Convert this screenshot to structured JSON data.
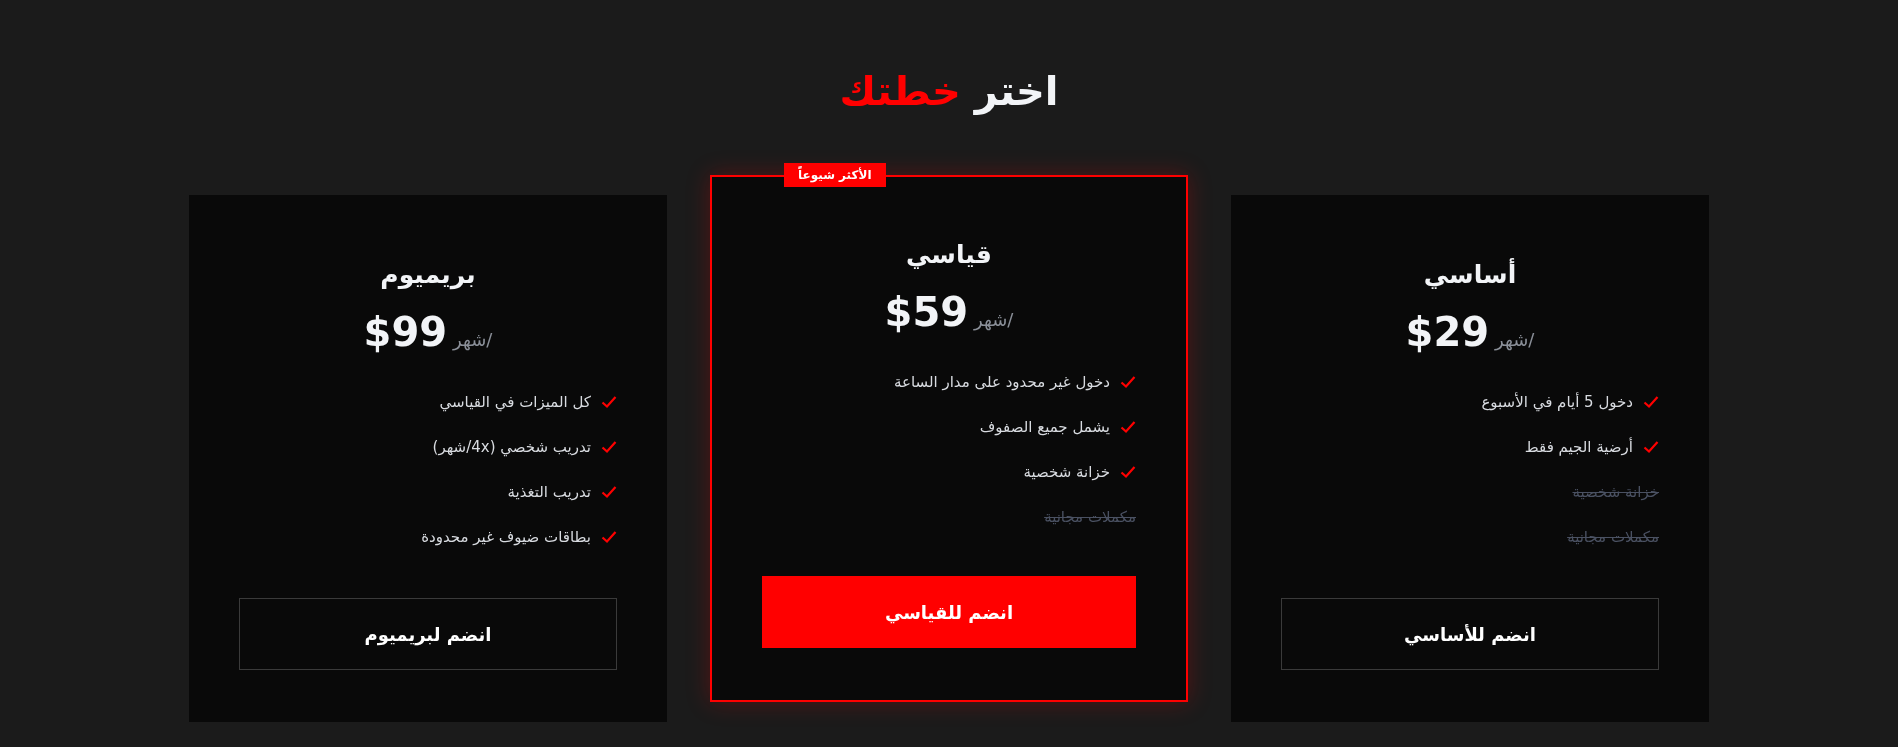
{
  "title": {
    "lead": "اختر",
    "highlight": "خطتك"
  },
  "plans": [
    {
      "name": "أساسي",
      "price": "$29",
      "period": "/شهر",
      "featured": false,
      "features": [
        {
          "text": "دخول 5 أيام في الأسبوع",
          "included": true
        },
        {
          "text": "أرضية الجيم فقط",
          "included": true
        },
        {
          "text": "خزانة شخصية",
          "included": false
        },
        {
          "text": "مكملات مجانية",
          "included": false
        }
      ],
      "button": "انضم للأساسي"
    },
    {
      "name": "قياسي",
      "price": "$59",
      "period": "/شهر",
      "featured": true,
      "badge": "الأكثر شيوعاً",
      "features": [
        {
          "text": "دخول غير محدود على مدار الساعة",
          "included": true
        },
        {
          "text": "يشمل جميع الصفوف",
          "included": true
        },
        {
          "text": "خزانة شخصية",
          "included": true
        },
        {
          "text": "مكملات مجانية",
          "included": false
        }
      ],
      "button": "انضم للقياسي"
    },
    {
      "name": "بريميوم",
      "price": "$99",
      "period": "/شهر",
      "featured": false,
      "features": [
        {
          "text": "كل الميزات في القياسي",
          "included": true
        },
        {
          "text": "تدريب شخصي (4x/شهر)",
          "included": true
        },
        {
          "text": "تدريب التغذية",
          "included": true
        },
        {
          "text": "بطاقات ضيوف غير محدودة",
          "included": true
        }
      ],
      "button": "انضم لبريميوم"
    }
  ]
}
